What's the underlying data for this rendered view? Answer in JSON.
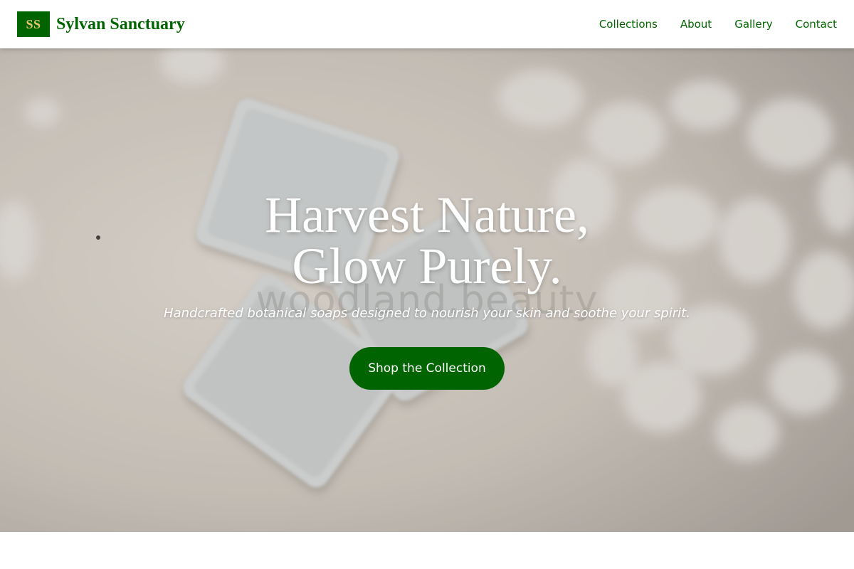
{
  "header": {
    "logo_mark": "SS",
    "brand_name": "Sylvan Sanctuary",
    "nav": [
      {
        "label": "Collections"
      },
      {
        "label": "About"
      },
      {
        "label": "Gallery"
      },
      {
        "label": "Contact"
      }
    ]
  },
  "hero": {
    "title_line1": "Harvest Nature,",
    "title_line2": "Glow Purely.",
    "watermark": "woodland.beauty",
    "subtitle": "Handcrafted botanical soaps designed to nourish your skin and soothe your spirit.",
    "cta_label": "Shop the Collection"
  },
  "colors": {
    "brand_green": "#006400",
    "logo_text_gold": "#e9c46a",
    "header_bg": "#ffffff",
    "hero_text": "#ffffff"
  }
}
